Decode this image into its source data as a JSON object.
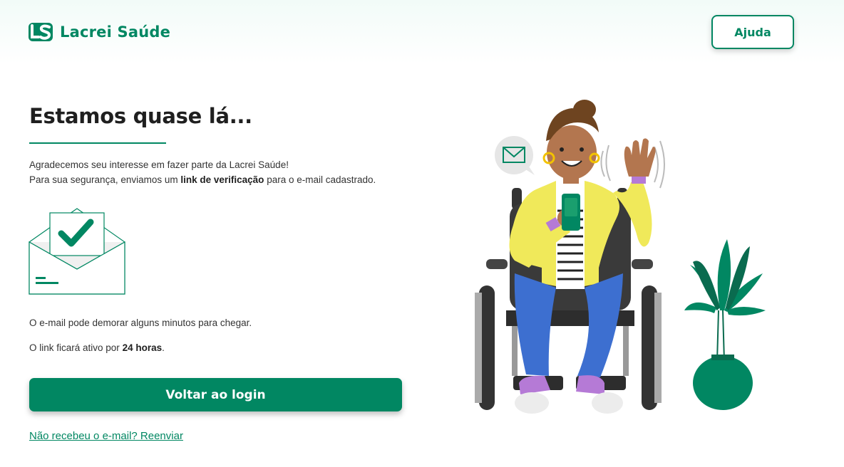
{
  "brand": {
    "name": "Lacrei Saúde",
    "accent_color": "#018762"
  },
  "header": {
    "help_label": "Ajuda"
  },
  "main": {
    "title": "Estamos quase lá...",
    "intro_line1": "Agradecemos seu interesse em fazer parte da Lacrei Saúde!",
    "intro_line2_prefix": "Para sua segurança, enviamos um ",
    "intro_line2_bold": "link de verificação",
    "intro_line2_suffix": " para o e-mail cadastrado.",
    "note_delay": "O e-mail pode demorar alguns minutos para chegar.",
    "note_active_prefix": "O link ficará ativo por ",
    "note_active_bold": "24 horas",
    "note_active_suffix": ".",
    "back_to_login_label": "Voltar ao login",
    "resend_link_label": "Não recebeu o e-mail? Reenviar"
  },
  "icons": {
    "logo": "lacrei-logo-icon",
    "envelope": "envelope-check-icon",
    "illustration": "wheelchair-person-waving-illustration"
  }
}
